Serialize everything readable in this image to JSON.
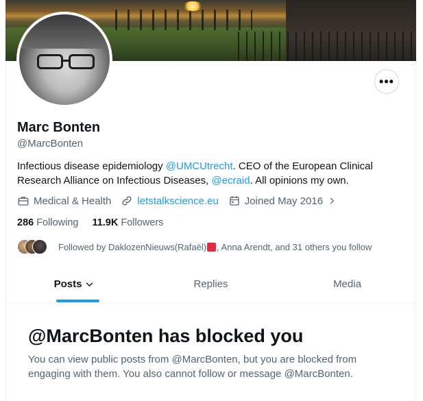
{
  "profile": {
    "name": "Marc Bonten",
    "handle": "@MarcBonten",
    "bio_prefix": "Infectious disease epidemiology ",
    "bio_mention1": "@UMCUtrecht",
    "bio_middle": ". CEO of the European Clinical Research Alliance on Infectious Diseases, ",
    "bio_mention2": "@ecraid",
    "bio_suffix": ". All opinions my own.",
    "category": "Medical & Health",
    "website": "letstalkscience.eu",
    "joined": "Joined May 2016",
    "following_count": "286",
    "following_label": "Following",
    "followers_count": "11.9K",
    "followers_label": "Followers",
    "followed_by_prefix": "Followed by DaklozenNieuws(Rafaël)",
    "followed_by_suffix": ", Anna Arendt, and 31 others you follow"
  },
  "more_button": "•••",
  "tabs": [
    {
      "label": "Posts"
    },
    {
      "label": "Replies"
    },
    {
      "label": "Media"
    }
  ],
  "blocked": {
    "title": "@MarcBonten has blocked you",
    "message": "You can view public posts from @MarcBonten, but you are blocked from engaging with them. You also cannot follow or message @MarcBonten."
  },
  "colors": {
    "accent": "#1d9bf0",
    "secondary_text": "#536471",
    "primary_text": "#0f1419"
  },
  "icons": {
    "category": "briefcase-icon",
    "website": "link-icon",
    "joined": "calendar-icon",
    "joined_arrow": "chevron-right-icon",
    "tab_arrow": "chevron-down-icon"
  }
}
